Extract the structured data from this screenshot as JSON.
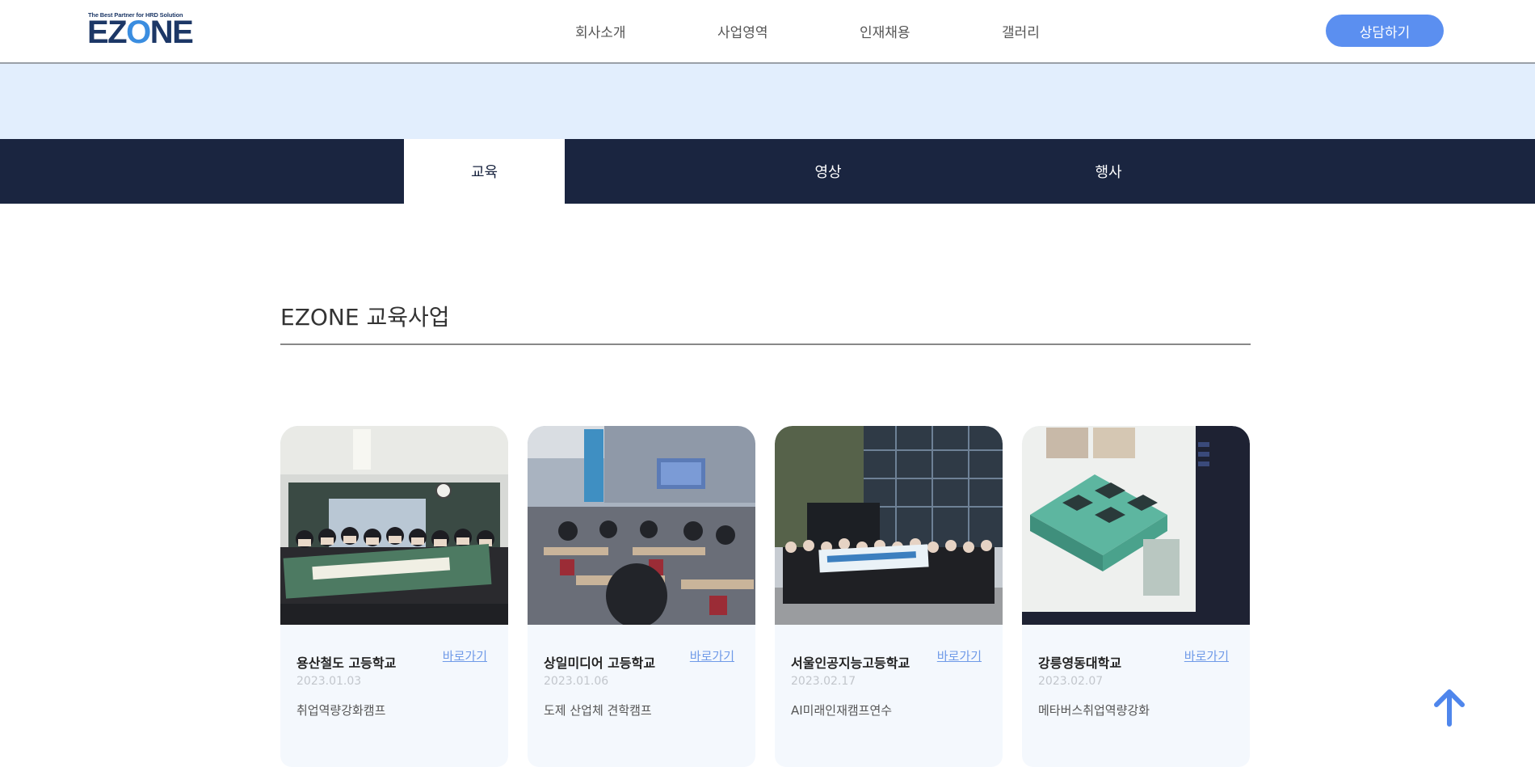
{
  "header": {
    "logo_tagline": "The Best Partner for HRD Solution",
    "logo_text_a": "EZ",
    "logo_text_o": "O",
    "logo_text_b": "NE",
    "nav": [
      "회사소개",
      "사업영역",
      "인재채용",
      "갤러리"
    ],
    "cta_label": "상담하기"
  },
  "tabs": [
    {
      "label": "교육",
      "active": true
    },
    {
      "label": "영상",
      "active": false
    },
    {
      "label": "행사",
      "active": false
    }
  ],
  "section": {
    "title": "EZONE 교육사업"
  },
  "cards": [
    {
      "name": "용산철도 고등학교",
      "link": "바로가기",
      "date": "2023.01.03",
      "desc": "취업역량강화캠프"
    },
    {
      "name": "상일미디어 고등학교",
      "link": "바로가기",
      "date": "2023.01.06",
      "desc": "도제 산업체 견학캠프"
    },
    {
      "name": "서울인공지능고등학교",
      "link": "바로가기",
      "date": "2023.02.17",
      "desc": "AI미래인재캠프연수"
    },
    {
      "name": "강릉영동대학교",
      "link": "바로가기",
      "date": "2023.02.07",
      "desc": "메타버스취업역량강화"
    }
  ],
  "colors": {
    "brand_navy": "#1a2540",
    "accent_blue": "#5b8ff0",
    "banner_bg": "#e2eefd",
    "card_bg": "#f4f8fd"
  },
  "icons": {
    "scroll_top": "arrow-up-icon"
  }
}
